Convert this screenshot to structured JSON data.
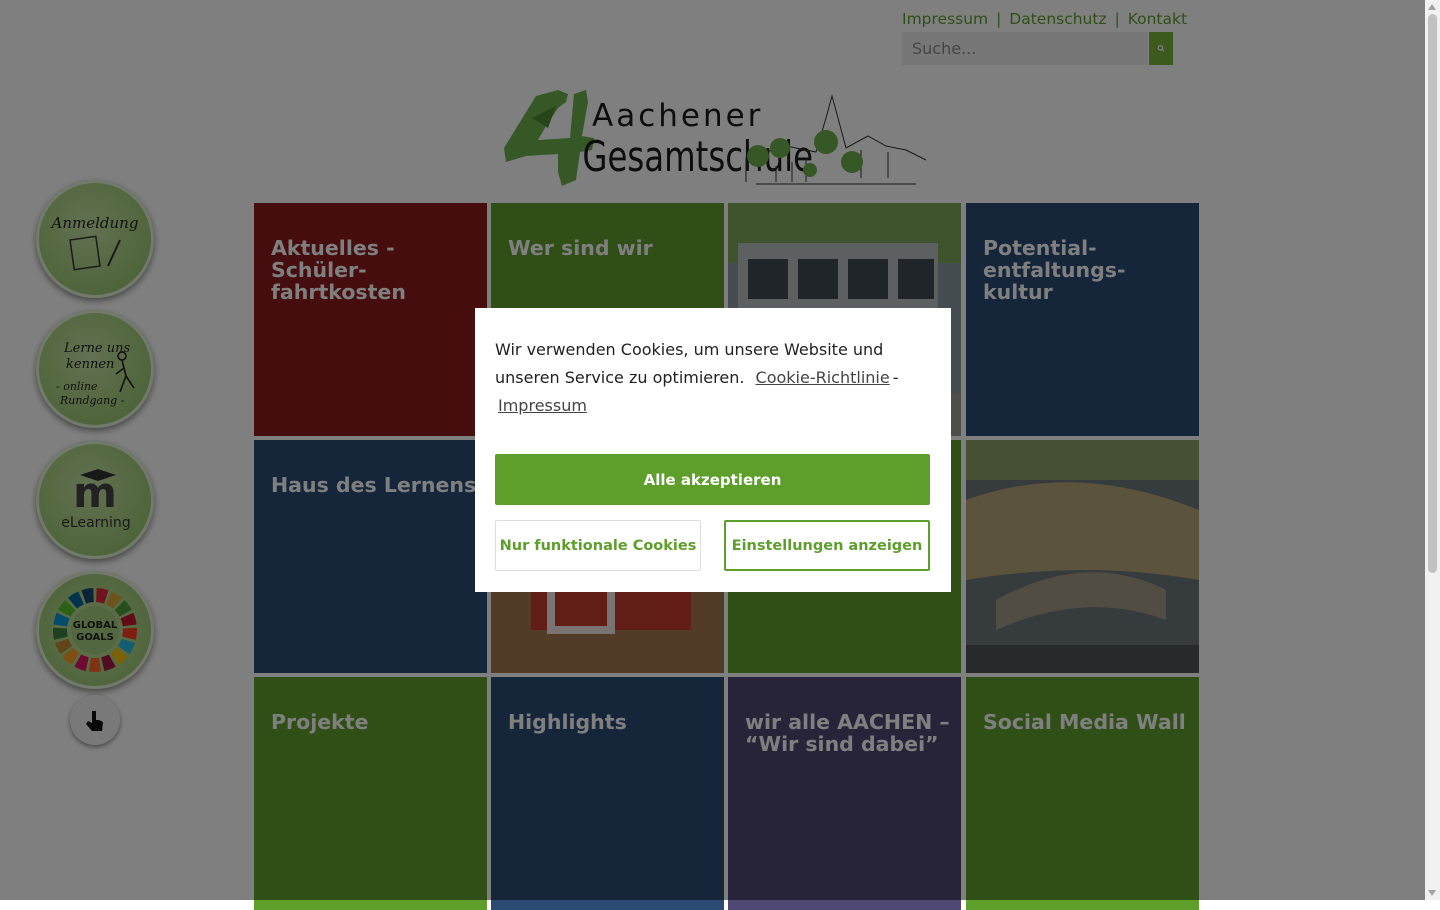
{
  "header": {
    "links": [
      "Impressum",
      "Datenschutz",
      "Kontakt"
    ],
    "separator": "|",
    "search_placeholder": "Suche..."
  },
  "logo": {
    "text_line1": "Aachener",
    "text_line2": "Gesamtschule",
    "number": "4"
  },
  "side_buttons": [
    {
      "name": "anmeldung",
      "label": "Anmeldung",
      "icon": "notebook-pencil-icon"
    },
    {
      "name": "lerne-uns-kennen",
      "label_line1": "Lerne uns",
      "label_line2": "kennen",
      "label_line3": "- online",
      "label_line4": "Rundgang -",
      "icon": "walking-figure-icon"
    },
    {
      "name": "elearning",
      "label": "eLearning",
      "icon": "moodle-icon",
      "icon_text": "m"
    },
    {
      "name": "global-goals",
      "label_line1": "GLOBAL",
      "label_line2": "GOALS",
      "icon": "sdg-wheel-icon"
    },
    {
      "name": "accessibility",
      "icon": "hand-pointer-icon"
    }
  ],
  "tiles": [
    {
      "title": "Aktuelles -\nSchüler-\nfahrtkosten",
      "color": "#8b1a1a"
    },
    {
      "title": "Wer sind wir",
      "color": "#5e9f2c"
    },
    {
      "title": "",
      "color": "#6f7f6a",
      "photo": true
    },
    {
      "title": "Potential-\nentfaltungs-\nkultur",
      "color": "#2b4a74"
    },
    {
      "title": "Haus des Lernens",
      "color": "#2b4a74"
    },
    {
      "title": "",
      "color": "#a33a2c",
      "photo": true
    },
    {
      "title": "",
      "color": "#5e9f2c"
    },
    {
      "title": "",
      "color": "#5a6670",
      "photo": true
    },
    {
      "title": "Projekte",
      "color": "#5e9f2c"
    },
    {
      "title": "Highlights",
      "color": "#2b4a74"
    },
    {
      "title": "wir alle AACHEN –\n“Wir sind dabei”",
      "color": "#4e4873"
    },
    {
      "title": "Social Media Wall",
      "color": "#5e9f2c"
    }
  ],
  "cookie": {
    "message": "Wir verwenden Cookies, um unsere Website und unseren Service zu optimieren.",
    "policy_link": "Cookie-Richtlinie",
    "dash": "-",
    "impressum_link": "Impressum",
    "accept_all": "Alle akzeptieren",
    "functional_only": "Nur funktionale Cookies",
    "show_settings": "Einstellungen anzeigen"
  },
  "colors": {
    "brand_green": "#5e9f2c",
    "search_button": "#78b43a"
  }
}
